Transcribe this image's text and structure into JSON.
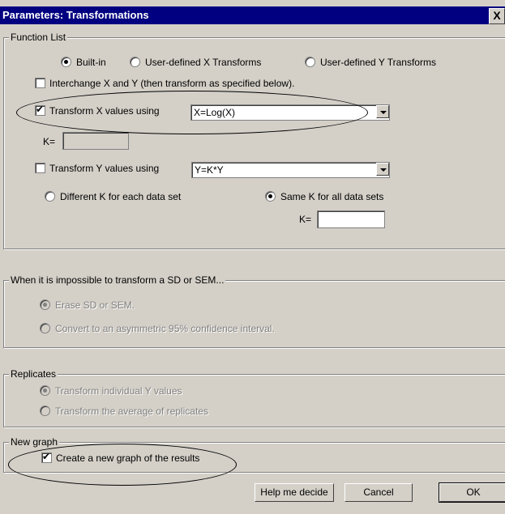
{
  "window": {
    "title": "Parameters: Transformations",
    "close_label": "X"
  },
  "function_list": {
    "legend": "Function List",
    "radio_builtin": "Built-in",
    "radio_user_x": "User-defined X Transforms",
    "radio_user_y": "User-defined Y Transforms",
    "interchange_label": "Interchange X and Y (then transform as specified below).",
    "transform_x_label": "Transform X values using",
    "transform_x_value": "X=Log(X)",
    "kx_label": "K=",
    "transform_y_label": "Transform Y values using",
    "transform_y_value": "Y=K*Y",
    "different_k_label": "Different K for each data set",
    "same_k_label": "Same K for all data sets",
    "ky_label": "K="
  },
  "sd_group": {
    "legend": "When it is impossible to transform a SD or SEM...",
    "erase_label": "Erase SD or SEM.",
    "convert_label": "Convert to an asymmetric 95% confidence interval."
  },
  "replicates": {
    "legend": "Replicates",
    "individual_label": "Transform individual Y values",
    "average_label": "Transform the average of replicates"
  },
  "new_graph": {
    "legend": "New graph",
    "create_label": "Create a new graph of the results"
  },
  "buttons": {
    "help": "Help me decide",
    "cancel": "Cancel",
    "ok": "OK"
  }
}
